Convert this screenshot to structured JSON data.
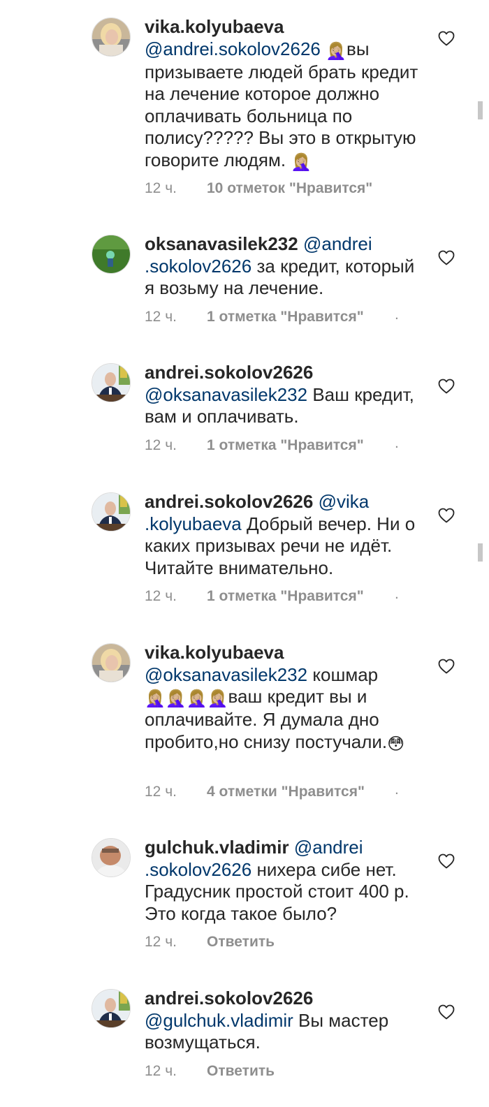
{
  "comments": [
    {
      "username": "vika.kolyubaeva",
      "mention": "@andrei.sokolov2626",
      "emoji1": "🤦🏼‍♀️",
      "text": "вы призываете людей брать кредит на лечение которое должно оплачивать больница по полису????? Вы это в открытую говорите людям.",
      "emoji2": "🤦🏼‍♀️",
      "time": "12 ч.",
      "likes": "10 отметок \"Нравится\""
    },
    {
      "username": "oksanavasilek232",
      "mention": "@andrei .sokolov2626",
      "text": "за кредит, который я возьму на лечение.",
      "time": "12 ч.",
      "likes": "1 отметка \"Нравится\"",
      "dot": "."
    },
    {
      "username": "andrei.sokolov2626",
      "mention": "@oksanavasilek232",
      "text": "Ваш кредит, вам и оплачивать.",
      "time": "12 ч.",
      "likes": "1 отметка \"Нравится\"",
      "dot": "."
    },
    {
      "username": "andrei.sokolov2626",
      "mention": "@vika .kolyubaeva",
      "text": "Добрый вечер. Ни о каких призывах речи не идёт. Читайте внимательно.",
      "time": "12 ч.",
      "likes": "1 отметка \"Нравится\"",
      "dot": "."
    },
    {
      "username": "vika.kolyubaeva",
      "mention": "@oksanavasilek232",
      "text_a": "кошмар",
      "emojis": "🤦🏼‍♀️🤦🏼‍♀️🤦🏼‍♀️🤦🏼‍♀️",
      "text_b": "ваш кредит вы и оплачивайте. Я думала дно пробито,но снизу постучали.",
      "emoji_end": "😳",
      "time": "12 ч.",
      "likes": "4 отметки \"Нравится\"",
      "dot": "."
    },
    {
      "username": "gulchuk.vladimir",
      "mention": "@andrei .sokolov2626",
      "text": "нихера сибе нет. Градусник простой стоит 400 р. Это когда такое было?",
      "time": "12 ч.",
      "reply": "Ответить"
    },
    {
      "username": "andrei.sokolov2626",
      "mention": "@gulchuk.vladimir",
      "text": "Вы мастер возмущаться.",
      "time": "12 ч.",
      "reply": "Ответить"
    }
  ],
  "icons": {
    "like": "heart-outline-icon"
  },
  "colors": {
    "mention": "#00376b",
    "meta": "#8e8e8e",
    "text": "#262626"
  }
}
